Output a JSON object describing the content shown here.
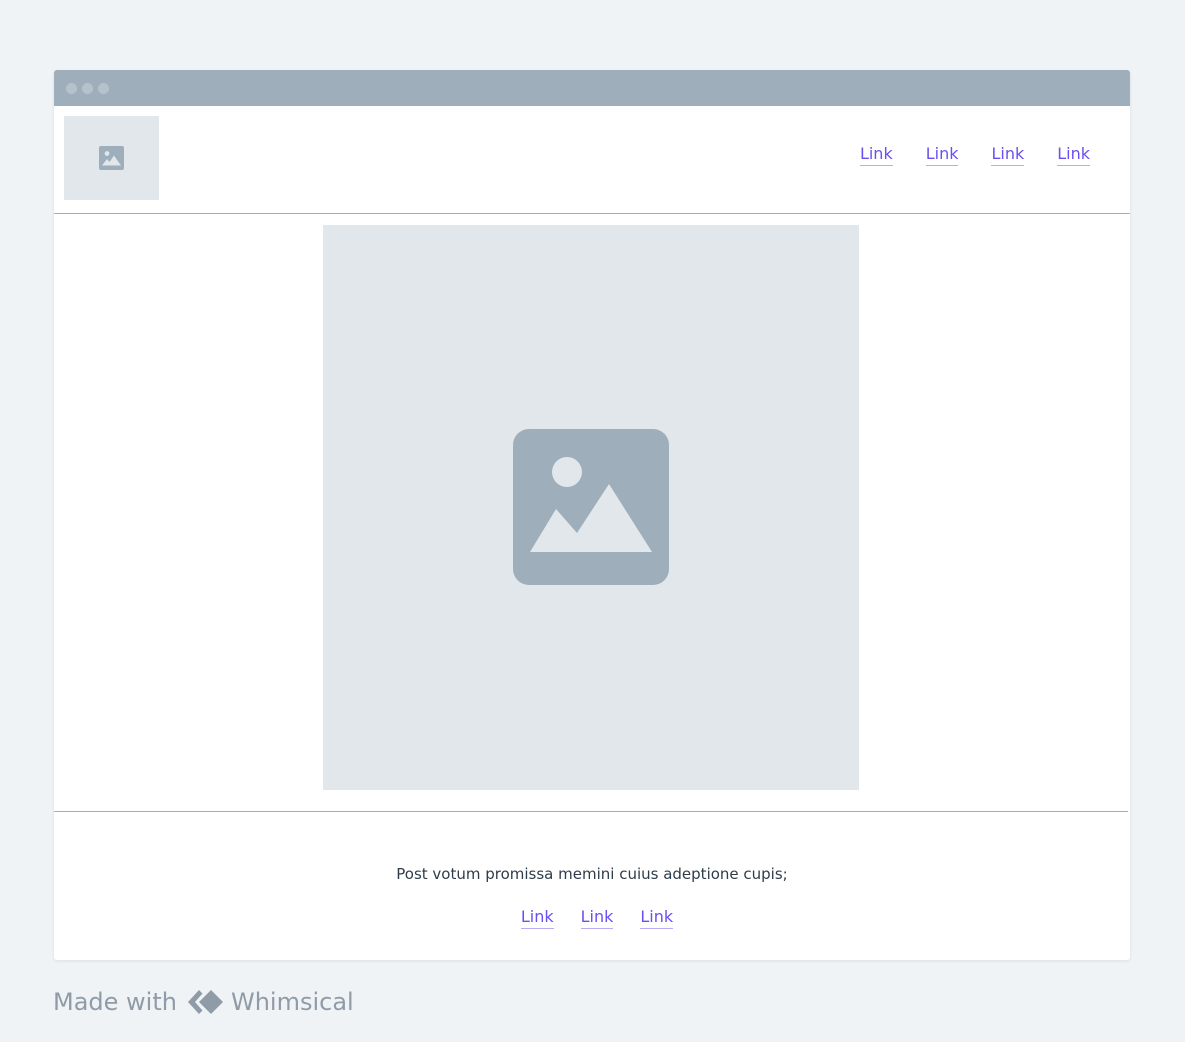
{
  "header": {
    "nav_links": [
      "Link",
      "Link",
      "Link",
      "Link"
    ]
  },
  "footer": {
    "text": "Post votum promissa memini cuius adeptione cupis;",
    "links": [
      "Link",
      "Link",
      "Link"
    ]
  },
  "branding": {
    "made_with": "Made with",
    "brand": "Whimsical"
  },
  "icons": {
    "logo": "image-placeholder-icon",
    "hero": "image-placeholder-icon",
    "brand": "whimsical-logo-icon"
  },
  "colors": {
    "background": "#f0f3f6",
    "titlebar": "#9eaeba",
    "placeholder": "#e1e7eb",
    "link": "#6b4ff0",
    "text": "#2f3d4a"
  }
}
